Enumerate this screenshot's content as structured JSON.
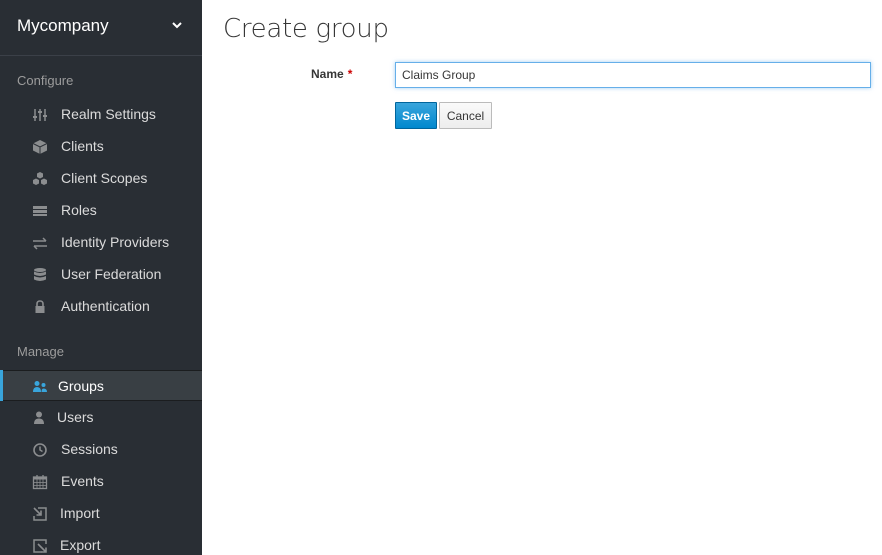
{
  "realm": {
    "name": "Mycompany",
    "chevron_icon": "chevron-down-icon"
  },
  "sidebar": {
    "configure_header": "Configure",
    "configure_items": [
      {
        "label": "Realm Settings",
        "icon": "sliders-icon"
      },
      {
        "label": "Clients",
        "icon": "cube-icon"
      },
      {
        "label": "Client Scopes",
        "icon": "cubes-icon"
      },
      {
        "label": "Roles",
        "icon": "list-icon"
      },
      {
        "label": "Identity Providers",
        "icon": "exchange-icon"
      },
      {
        "label": "User Federation",
        "icon": "database-icon"
      },
      {
        "label": "Authentication",
        "icon": "lock-icon"
      }
    ],
    "manage_header": "Manage",
    "manage_items": [
      {
        "label": "Groups",
        "icon": "users-icon",
        "active": true
      },
      {
        "label": "Users",
        "icon": "user-icon"
      },
      {
        "label": "Sessions",
        "icon": "clock-icon"
      },
      {
        "label": "Events",
        "icon": "calendar-icon"
      },
      {
        "label": "Import",
        "icon": "import-icon"
      },
      {
        "label": "Export",
        "icon": "export-icon"
      }
    ]
  },
  "main": {
    "title": "Create group",
    "name_label": "Name",
    "required_marker": "*",
    "name_value": "Claims Group",
    "save_label": "Save",
    "cancel_label": "Cancel"
  },
  "colors": {
    "sidebar_bg": "#292e34",
    "active_accent": "#39a5dc",
    "primary_button": "#0088ce",
    "required": "#cc0000"
  }
}
